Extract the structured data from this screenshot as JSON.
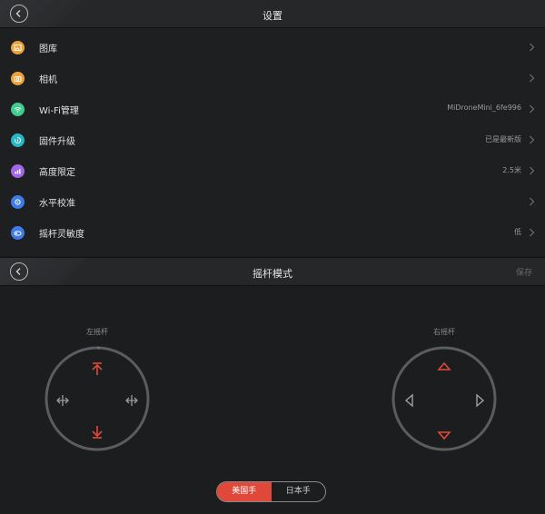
{
  "settings": {
    "title": "设置",
    "items": [
      {
        "label": "图库",
        "value": "",
        "icon": "gallery-icon",
        "color": "#f0a23a"
      },
      {
        "label": "相机",
        "value": "",
        "icon": "camera-icon",
        "color": "#f0a23a"
      },
      {
        "label": "Wi-Fi管理",
        "value": "MiDroneMini_6fe996",
        "icon": "wifi-icon",
        "color": "#3ecf8e"
      },
      {
        "label": "固件升级",
        "value": "已是最新版",
        "icon": "firmware-icon",
        "color": "#28b7c9"
      },
      {
        "label": "高度限定",
        "value": "2.5米",
        "icon": "altitude-icon",
        "color": "#a167e6"
      },
      {
        "label": "水平校准",
        "value": "",
        "icon": "level-icon",
        "color": "#3f7be8"
      },
      {
        "label": "摇杆灵敏度",
        "value": "低",
        "icon": "joystick-icon",
        "color": "#3f7be8"
      }
    ]
  },
  "stick_mode": {
    "title": "摇杆模式",
    "save_label": "保存",
    "left_label": "左摇杆",
    "right_label": "右摇杆",
    "mode_options": [
      "美国手",
      "日本手"
    ],
    "selected_mode": "美国手",
    "accent_color": "#e0493a"
  }
}
